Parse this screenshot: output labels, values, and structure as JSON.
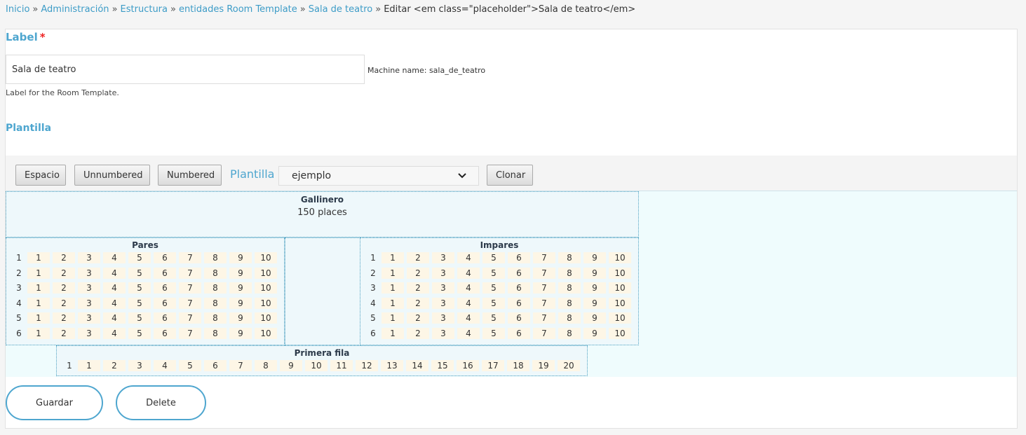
{
  "breadcrumb": {
    "items": [
      "Inicio",
      "Administración",
      "Estructura",
      "entidades Room Template",
      "Sala de teatro"
    ],
    "separator": "»",
    "current": "Editar <em class=\"placeholder\">Sala de teatro</em>"
  },
  "form": {
    "label_title": "Label",
    "required_mark": "*",
    "label_value": "Sala de teatro",
    "machine_name": "Machine name: sala_de_teatro",
    "description": "Label for the Room Template.",
    "plantilla_title": "Plantilla"
  },
  "toolbar": {
    "espacio": "Espacio",
    "unnumbered": "Unnumbered",
    "numbered": "Numbered",
    "plantilla_label": "Plantilla",
    "select_value": "ejemplo",
    "clonar": "Clonar"
  },
  "zones": {
    "gallinero": {
      "title": "Gallinero",
      "subtitle": "150 places"
    },
    "pares": {
      "title": "Pares",
      "rows": [
        "1",
        "2",
        "3",
        "4",
        "5",
        "6"
      ],
      "seats": [
        "1",
        "2",
        "3",
        "4",
        "5",
        "6",
        "7",
        "8",
        "9",
        "10"
      ]
    },
    "impares": {
      "title": "Impares",
      "rows": [
        "1",
        "2",
        "3",
        "4",
        "5",
        "6"
      ],
      "seats": [
        "1",
        "2",
        "3",
        "4",
        "5",
        "6",
        "7",
        "8",
        "9",
        "10"
      ]
    },
    "primera": {
      "title": "Primera fila",
      "rows": [
        "1"
      ],
      "seats": [
        "1",
        "2",
        "3",
        "4",
        "5",
        "6",
        "7",
        "8",
        "9",
        "10",
        "11",
        "12",
        "13",
        "14",
        "15",
        "16",
        "17",
        "18",
        "19",
        "20"
      ]
    }
  },
  "actions": {
    "save": "Guardar",
    "delete": "Delete"
  },
  "colors": {
    "accent": "#4ea6cf",
    "seat_bg": "#fdf6e6",
    "zone_border": "#4a9fc0"
  }
}
